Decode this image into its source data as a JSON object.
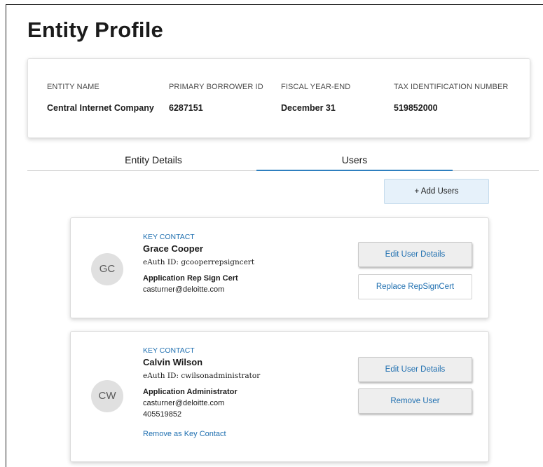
{
  "page": {
    "title": "Entity Profile"
  },
  "summary": {
    "entity_name": {
      "label": "ENTITY NAME",
      "value": "Central Internet Company"
    },
    "primary_borrower_id": {
      "label": "PRIMARY BORROWER ID",
      "value": "6287151"
    },
    "fiscal_year_end": {
      "label": "FISCAL YEAR-END",
      "value": "December 31"
    },
    "tax_id": {
      "label": "TAX IDENTIFICATION NUMBER",
      "value": "519852000"
    }
  },
  "tabs": [
    {
      "label": "Entity Details",
      "active": false
    },
    {
      "label": "Users",
      "active": true
    }
  ],
  "actions": {
    "add_users": "+ Add Users"
  },
  "users": [
    {
      "initials": "GC",
      "tag": "KEY CONTACT",
      "name": "Grace  Cooper",
      "eauth": "eAuth ID: gcooperrepsigncert",
      "role": "Application Rep Sign Cert",
      "email": "casturner@deloitte.com",
      "buttons": {
        "edit": "Edit User Details",
        "secondary": "Replace RepSignCert"
      }
    },
    {
      "initials": "CW",
      "tag": "KEY CONTACT",
      "name": "Calvin  Wilson",
      "eauth": "eAuth ID: cwilsonadministrator",
      "role": "Application Administrator",
      "email": "casturner@deloitte.com",
      "phone": "405519852",
      "link": "Remove as Key Contact",
      "buttons": {
        "edit": "Edit User Details",
        "secondary": "Remove User"
      }
    }
  ],
  "colors": {
    "accent": "#1f6fb0",
    "tab_underline": "#2e7fbf",
    "add_button_bg": "#e6f1fa"
  }
}
